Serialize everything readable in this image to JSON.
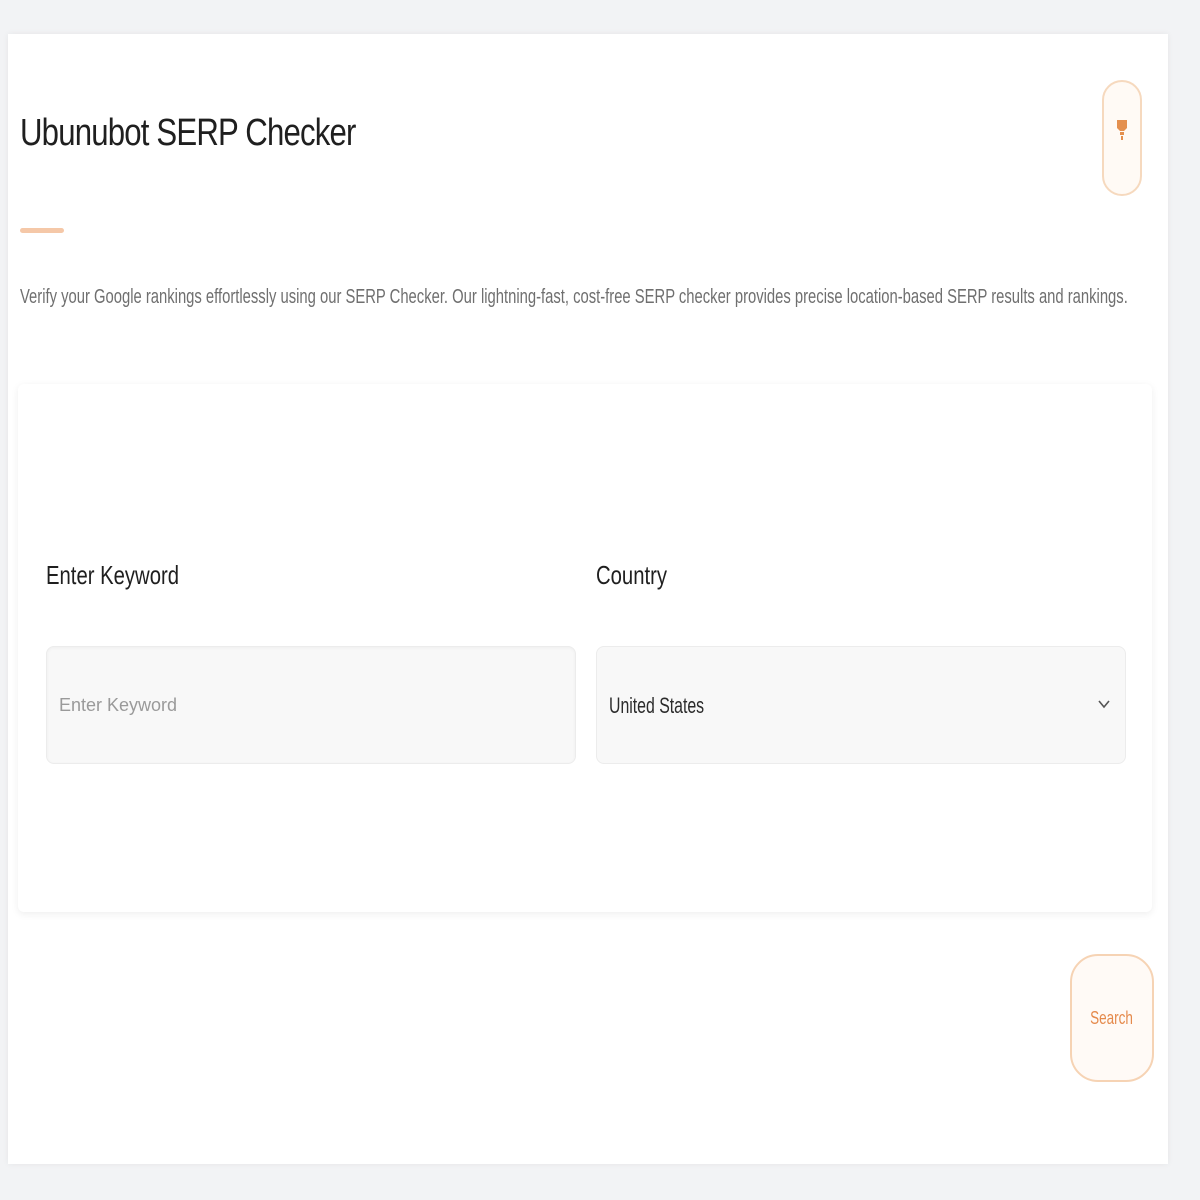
{
  "header": {
    "title": "Ubunubot SERP Checker",
    "description": "Verify your Google rankings effortlessly using our SERP Checker. Our lightning-fast, cost-free SERP checker provides precise location-based SERP results and rankings."
  },
  "theme_toggle": {
    "icon": "lightbulb-icon"
  },
  "form": {
    "keyword_label": "Enter Keyword",
    "keyword_placeholder": "Enter Keyword",
    "keyword_value": "",
    "country_label": "Country",
    "country_selected": "United States",
    "country_icon": "chevron-down-icon"
  },
  "actions": {
    "search_label": "Search"
  },
  "colors": {
    "accent": "#e58a4c",
    "accent_light": "#f5c8a8",
    "background": "#f2f3f5",
    "card": "#ffffff"
  }
}
